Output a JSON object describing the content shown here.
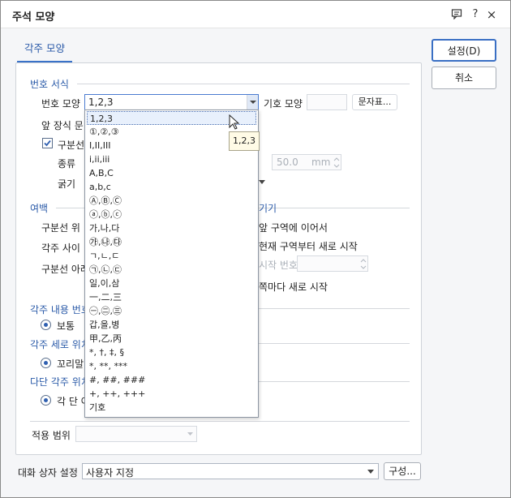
{
  "window": {
    "title": "주석 모양",
    "buttons": [
      "chat-icon",
      "help",
      "close"
    ],
    "help_label": "?",
    "close_label": "×"
  },
  "tab": {
    "label": "각주 모양"
  },
  "numbering": {
    "section_label": "번호 서식",
    "format_label": "번호 모양",
    "format_value": "1,2,3",
    "symbol_label": "기호 모양",
    "symbol_value": "",
    "charmap_button": "문자표...",
    "prefix_label": "앞 장식 문"
  },
  "separator": {
    "checkbox_label": "구분선",
    "checked": true,
    "type_label": "종류",
    "width_label": "굵기",
    "length_value": "50.0",
    "length_unit": "mm"
  },
  "margin": {
    "section_label": "여백",
    "above_label": "구분선 위",
    "between_label": "각주 사이",
    "below_label": "구분선 아래"
  },
  "numbering_continue": {
    "section_label": "기기",
    "option1": "앞 구역에 이어서",
    "option2": "현재 구역부터 새로 시작",
    "start_label": "시작 번호",
    "option3": "쪽마다 새로 시작"
  },
  "content_number": {
    "section_label": "각주 내용 번호",
    "value": "보통"
  },
  "vertical_pos": {
    "section_label": "각주 세로 위치",
    "value": "꼬리말"
  },
  "multi_col": {
    "section_label": "다단 각주 위치",
    "value": "각 단 아"
  },
  "apply_scope": {
    "label": "적용 범위",
    "value": ""
  },
  "footer": {
    "dialog_setting_label": "대화 상자 설정",
    "dialog_setting_value": "사용자 지정",
    "config_button": "구성..."
  },
  "side_buttons": {
    "ok": "설정(D)",
    "cancel": "취소"
  },
  "dropdown": {
    "options": [
      "1,2,3",
      "①,②,③",
      "I,II,III",
      "i,ii,iii",
      "A,B,C",
      "a,b,c",
      "Ⓐ,Ⓑ,Ⓒ",
      "ⓐ,ⓑ,ⓒ",
      "가,나,다",
      "㉮,㉯,㉰",
      "ㄱ,ㄴ,ㄷ",
      "㉠,㉡,㉢",
      "일,이,삼",
      "一,二,三",
      "㊀,㊁,㊂",
      "갑,을,병",
      "甲,乙,丙",
      "*, †, ‡, §",
      "*, **, ***",
      "#, ##, ###",
      "+, ++, +++",
      "기호"
    ],
    "selected_index": 0
  },
  "tooltip": {
    "text": "1,2,3"
  },
  "colors": {
    "accent": "#2a5aa8",
    "tab_underline": "#3a72c8"
  }
}
